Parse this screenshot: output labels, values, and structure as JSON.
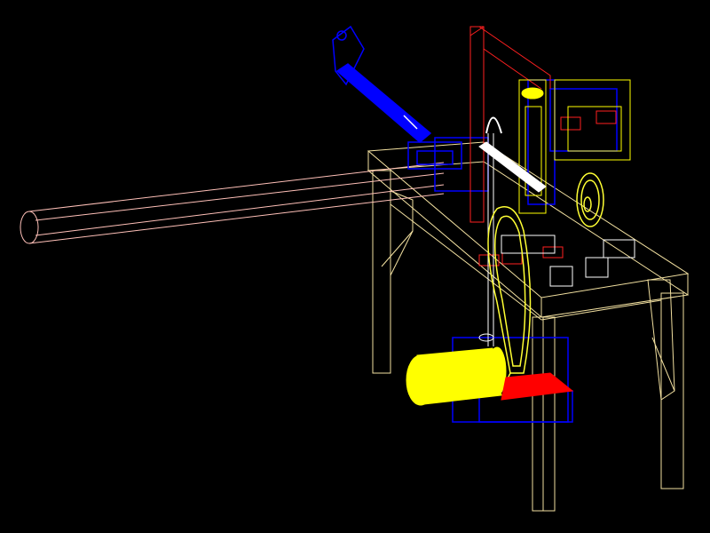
{
  "scene": {
    "background": "#000000",
    "render_style": "wireframe",
    "colors": {
      "frame": "#f2e0a0",
      "tube": "#ffc0b8",
      "motor": "#ffff00",
      "belt": "#ffff33",
      "drive": "#0000ff",
      "feed_bar": "#ffffff",
      "mounts": "#ff2020",
      "cutter_column": "#ffff00",
      "base_plate": "#ff0000"
    },
    "parts": {
      "table_frame": "frame",
      "long_tube": "tube",
      "motor": "motor",
      "belt_drive": "belt",
      "crank_arm": "drive",
      "feed_bar": "feed_bar",
      "column": "cutter_column",
      "bracket": "mounts",
      "pulley_right": "belt",
      "base_plate": "base_plate"
    }
  }
}
